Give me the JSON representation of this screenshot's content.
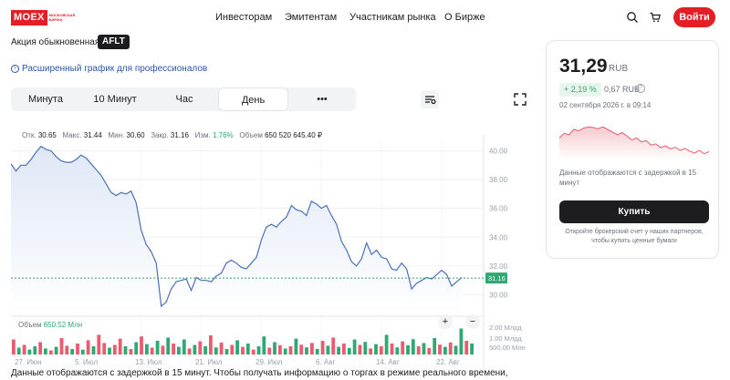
{
  "header": {
    "logo_text": "MOEX",
    "logo_sub": "МОСКОВСКАЯ БИРЖА",
    "nav": [
      "Инвесторам",
      "Эмитентам",
      "Участникам рынка",
      "О Бирже"
    ],
    "login_label": "Войти",
    "icons": [
      "search-icon",
      "cart-icon"
    ]
  },
  "security": {
    "type": "Акция обыкновенная",
    "ticker": "AFLT",
    "pro_link": "Расширенный график для профессионалов"
  },
  "period_tabs": [
    "Минута",
    "10 Минут",
    "Час",
    "День",
    "•••"
  ],
  "active_tab": "День",
  "stats": {
    "open_label": "Отк.",
    "open": "30.65",
    "high_label": "Макс.",
    "high": "31.44",
    "low_label": "Мин.",
    "low": "30.60",
    "close_label": "Закр.",
    "close": "31.16",
    "change_label": "Изм.",
    "change": "1.76%",
    "volume_label": "Объем",
    "volume": "650 520 645.40 ₽"
  },
  "volume_panel": {
    "label": "Объем",
    "value": "650.52 Млн"
  },
  "bottom_note": "Данные отображаются с задержкой в 15 минут. Чтобы получать информацию о торгах в режиме реального времени,",
  "card": {
    "price": "31,29",
    "currency": "RUB",
    "change_pct": "+ 2,19 %",
    "change_abs": "0,67 RUB",
    "date": "02 сентября 2026 г. в 09:14",
    "delay_note": "Данные отображаются с задержкой в 15 минут",
    "buy_label": "Купить",
    "broker_note": "Откройте брокерский счет у наших партнеров, чтобы купить ценные бумаги"
  },
  "colors": {
    "accent": "#e31e24",
    "line": "#4a72b8",
    "positive": "#2fa874",
    "negative": "#e95b6d",
    "price_tag": "#2fa874"
  },
  "chart_data": {
    "type": "line",
    "price_axis": {
      "ticks": [
        "40.00",
        "38.00",
        "36.00",
        "34.00",
        "32.00",
        "30.00"
      ],
      "min": 28.7,
      "max": 40.6
    },
    "x_ticks": [
      "27. Июн",
      "5. Июл",
      "13. Июл",
      "21. Июл",
      "29. Июл",
      "6. Авг",
      "14. Авг",
      "22. Авг"
    ],
    "last_price": "31.16",
    "series": [
      {
        "values": [
          39.1,
          38.6,
          39.0,
          39.0,
          39.4,
          39.9,
          40.3,
          40.1,
          40.0,
          39.6,
          39.3,
          39.2,
          39.2,
          39.4,
          39.7,
          39.5,
          39.1,
          38.7,
          38.3,
          37.7,
          37.1,
          36.9,
          37.1,
          37.0,
          37.2,
          36.4,
          34.5,
          33.5,
          33.0,
          32.2,
          29.2,
          29.5,
          30.4,
          30.9,
          31.0,
          31.1,
          30.3,
          31.2,
          31.0,
          31.0,
          30.9,
          31.3,
          31.5,
          32.2,
          32.4,
          32.2,
          31.9,
          31.8,
          32.2,
          32.6,
          33.8,
          34.7,
          34.9,
          34.7,
          35.1,
          35.4,
          36.2,
          35.9,
          35.8,
          35.5,
          36.5,
          36.3,
          36.0,
          36.2,
          35.5,
          34.9,
          33.7,
          33.1,
          32.3,
          32.0,
          32.5,
          33.6,
          32.8,
          33.1,
          32.6,
          32.5,
          31.8,
          31.7,
          32.2,
          31.8,
          30.4,
          30.8,
          31.0,
          31.2,
          31.1,
          31.4,
          31.7,
          31.4,
          30.6,
          30.9,
          31.2
        ]
      }
    ],
    "volume_axis": {
      "ticks": [
        "2.00 Млрд",
        "1.00 Млрд",
        "500.00 Млн"
      ]
    },
    "volume_bars": [
      {
        "v": 0.55,
        "up": false
      },
      {
        "v": 0.25,
        "up": true
      },
      {
        "v": 0.35,
        "up": false
      },
      {
        "v": 0.18,
        "up": true
      },
      {
        "v": 0.3,
        "up": true
      },
      {
        "v": 0.45,
        "up": false
      },
      {
        "v": 0.22,
        "up": true
      },
      {
        "v": 0.15,
        "up": false
      },
      {
        "v": 0.28,
        "up": true
      },
      {
        "v": 0.6,
        "up": false
      },
      {
        "v": 0.32,
        "up": false
      },
      {
        "v": 0.2,
        "up": true
      },
      {
        "v": 0.4,
        "up": false
      },
      {
        "v": 0.18,
        "up": true
      },
      {
        "v": 0.52,
        "up": false
      },
      {
        "v": 0.3,
        "up": true
      },
      {
        "v": 0.72,
        "up": false
      },
      {
        "v": 0.42,
        "up": false
      },
      {
        "v": 0.25,
        "up": true
      },
      {
        "v": 0.35,
        "up": false
      },
      {
        "v": 0.58,
        "up": false
      },
      {
        "v": 0.3,
        "up": true
      },
      {
        "v": 0.2,
        "up": false
      },
      {
        "v": 0.45,
        "up": true
      },
      {
        "v": 0.66,
        "up": false
      },
      {
        "v": 0.38,
        "up": true
      },
      {
        "v": 0.25,
        "up": false
      },
      {
        "v": 0.5,
        "up": true
      },
      {
        "v": 0.32,
        "up": false
      },
      {
        "v": 0.62,
        "up": true
      },
      {
        "v": 0.4,
        "up": false
      },
      {
        "v": 0.28,
        "up": true
      },
      {
        "v": 0.55,
        "up": true
      },
      {
        "v": 0.22,
        "up": false
      },
      {
        "v": 0.35,
        "up": true
      },
      {
        "v": 0.48,
        "up": false
      },
      {
        "v": 0.3,
        "up": true
      },
      {
        "v": 0.7,
        "up": false
      },
      {
        "v": 0.26,
        "up": true
      },
      {
        "v": 0.44,
        "up": false
      },
      {
        "v": 0.2,
        "up": true
      },
      {
        "v": 0.35,
        "up": false
      },
      {
        "v": 0.52,
        "up": true
      },
      {
        "v": 0.28,
        "up": false
      },
      {
        "v": 0.4,
        "up": true
      },
      {
        "v": 0.18,
        "up": false
      },
      {
        "v": 0.3,
        "up": true
      },
      {
        "v": 0.66,
        "up": true
      },
      {
        "v": 0.25,
        "up": false
      },
      {
        "v": 0.45,
        "up": true
      },
      {
        "v": 0.34,
        "up": false
      },
      {
        "v": 0.22,
        "up": true
      },
      {
        "v": 0.3,
        "up": false
      },
      {
        "v": 0.58,
        "up": true
      },
      {
        "v": 0.36,
        "up": false
      },
      {
        "v": 0.26,
        "up": true
      },
      {
        "v": 0.42,
        "up": false
      },
      {
        "v": 0.2,
        "up": true
      },
      {
        "v": 0.5,
        "up": false
      },
      {
        "v": 0.32,
        "up": true
      },
      {
        "v": 0.62,
        "up": false
      },
      {
        "v": 0.28,
        "up": true
      },
      {
        "v": 0.4,
        "up": false
      },
      {
        "v": 0.24,
        "up": true
      },
      {
        "v": 0.55,
        "up": true
      },
      {
        "v": 0.35,
        "up": false
      },
      {
        "v": 0.46,
        "up": true
      },
      {
        "v": 0.22,
        "up": false
      },
      {
        "v": 0.38,
        "up": true
      },
      {
        "v": 0.3,
        "up": false
      },
      {
        "v": 0.72,
        "up": true
      },
      {
        "v": 0.4,
        "up": false
      },
      {
        "v": 0.26,
        "up": true
      },
      {
        "v": 0.48,
        "up": false
      },
      {
        "v": 0.34,
        "up": true
      },
      {
        "v": 0.56,
        "up": true
      },
      {
        "v": 0.3,
        "up": false
      },
      {
        "v": 0.42,
        "up": true
      },
      {
        "v": 0.24,
        "up": false
      },
      {
        "v": 0.6,
        "up": true
      },
      {
        "v": 0.36,
        "up": false
      },
      {
        "v": 0.28,
        "up": true
      },
      {
        "v": 0.44,
        "up": false
      },
      {
        "v": 0.32,
        "up": true
      },
      {
        "v": 0.95,
        "up": true
      },
      {
        "v": 0.5,
        "up": false
      },
      {
        "v": 0.4,
        "up": true
      }
    ],
    "mini": {
      "values": [
        34.5,
        35.2,
        35.0,
        35.8,
        35.6,
        36.0,
        36.2,
        36.1,
        35.9,
        36.2,
        35.8,
        35.4,
        35.0,
        35.3,
        34.8,
        34.2,
        34.5,
        33.9,
        34.1,
        33.4,
        33.6,
        33.0,
        33.3,
        32.8,
        33.1,
        32.6,
        32.9,
        32.5,
        32.2,
        32.6,
        32.1,
        32.4
      ]
    }
  }
}
